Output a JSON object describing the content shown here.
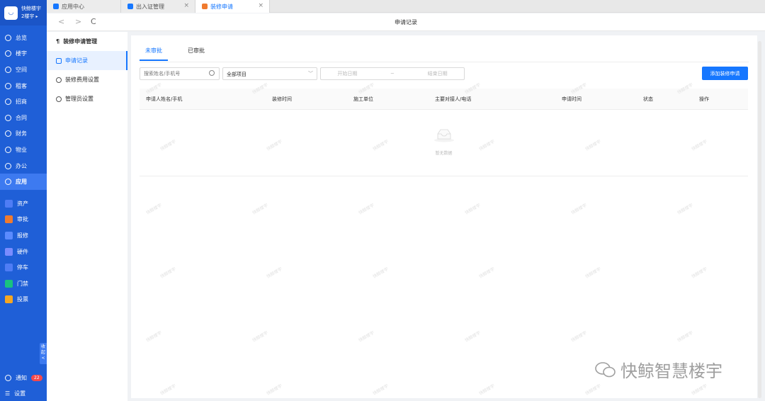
{
  "brand": {
    "name": "快鲸楼宇",
    "sub": "2楼宇",
    "arrow": "▸"
  },
  "nav": {
    "items": [
      "总览",
      "楼宇",
      "空间",
      "租客",
      "招商",
      "合同",
      "财务",
      "物业",
      "办公",
      "应用"
    ],
    "active": "应用"
  },
  "apps": [
    {
      "label": "资产",
      "color": "#4f7df5"
    },
    {
      "label": "审批",
      "color": "#f07b2f"
    },
    {
      "label": "报修",
      "color": "#5b8bff"
    },
    {
      "label": "硬件",
      "color": "#7a8cff"
    },
    {
      "label": "停车",
      "color": "#4f7df5"
    },
    {
      "label": "门禁",
      "color": "#19c27f"
    },
    {
      "label": "投票",
      "color": "#f5a623"
    }
  ],
  "collapse": {
    "text": "收起",
    "arrow": "<"
  },
  "bottom": {
    "notice": "通知",
    "badge": "22",
    "settings": "设置"
  },
  "tabs": [
    {
      "label": "应用中心",
      "color": "#1677ff"
    },
    {
      "label": "出入证管理",
      "color": "#1677ff",
      "close": "×"
    },
    {
      "label": "装修申请",
      "color": "#f07b2f",
      "close": "×"
    }
  ],
  "toolbar": {
    "back": "<",
    "forward": ">",
    "refresh": "C"
  },
  "page_title": "申请记录",
  "subnav": {
    "head": "装修申请管理",
    "items": [
      "申请记录",
      "装修费用设置",
      "管理员设置"
    ]
  },
  "status_tabs": [
    "未审批",
    "已审批"
  ],
  "filters": {
    "search_placeholder": "搜索姓名/手机号",
    "project": "全部项目",
    "start": "开始日期",
    "sep": "~",
    "end": "结束日期",
    "add": "添加装修申请"
  },
  "table": {
    "columns": [
      "申请人姓名/手机",
      "装修时间",
      "施工单位",
      "主要对接人/电话",
      "申请时间",
      "状态",
      "操作"
    ],
    "empty": "暂无数据"
  },
  "watermark_text": "快鲸楼宇",
  "watermark_brand": "快鲸智慧楼宇"
}
